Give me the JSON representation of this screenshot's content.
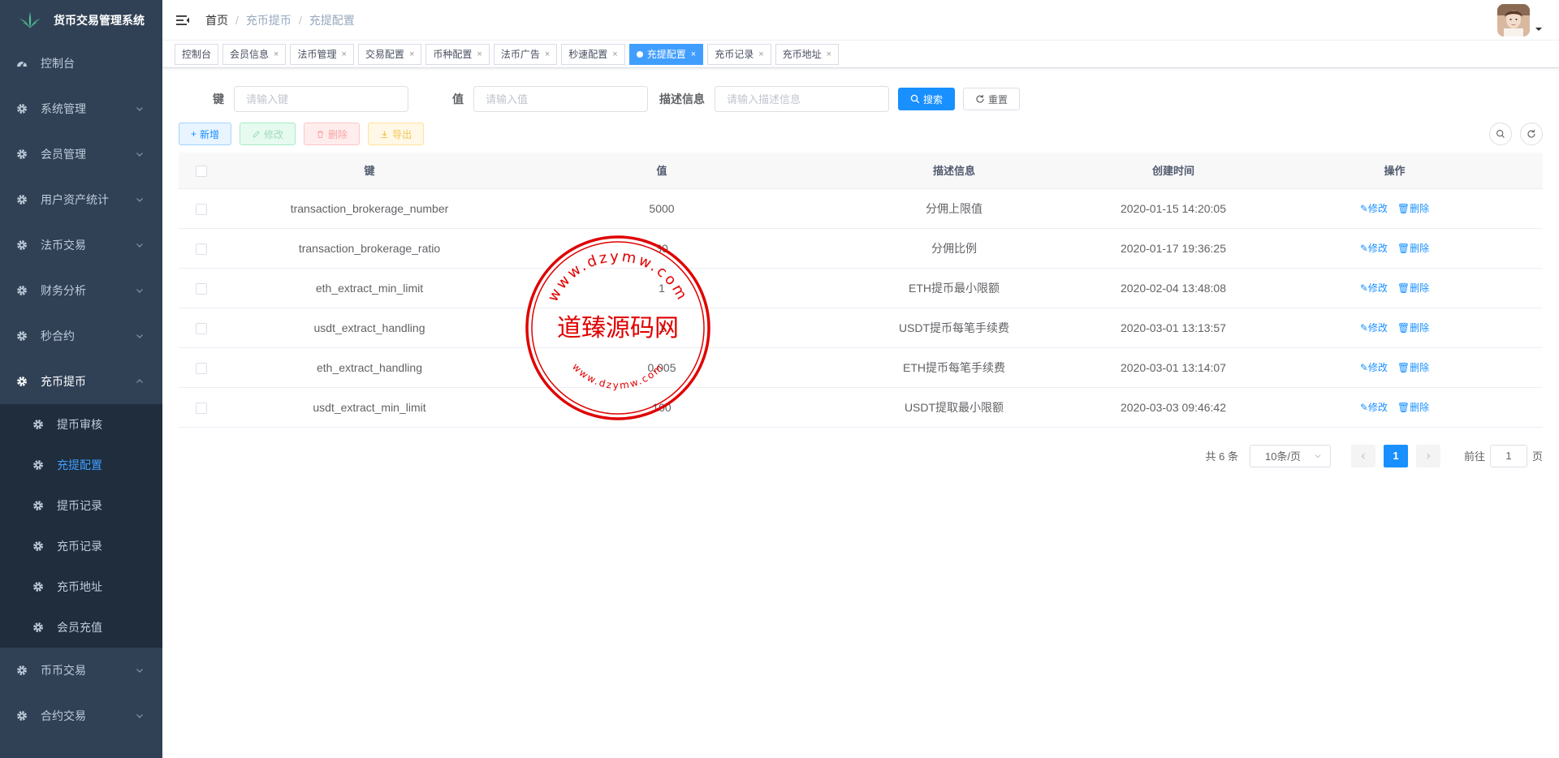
{
  "app": {
    "title": "货币交易管理系统"
  },
  "sidebar": {
    "items": [
      {
        "label": "控制台"
      },
      {
        "label": "系统管理"
      },
      {
        "label": "会员管理"
      },
      {
        "label": "用户资产统计"
      },
      {
        "label": "法币交易"
      },
      {
        "label": "财务分析"
      },
      {
        "label": "秒合约"
      },
      {
        "label": "充币提币"
      }
    ],
    "submenu": [
      {
        "label": "提币审核"
      },
      {
        "label": "充提配置"
      },
      {
        "label": "提币记录"
      },
      {
        "label": "充币记录"
      },
      {
        "label": "充币地址"
      },
      {
        "label": "会员充值"
      }
    ],
    "after": [
      {
        "label": "币币交易"
      },
      {
        "label": "合约交易"
      }
    ]
  },
  "breadcrumb": [
    "首页",
    "充币提币",
    "充提配置"
  ],
  "tabs": [
    {
      "label": "控制台"
    },
    {
      "label": "会员信息"
    },
    {
      "label": "法币管理"
    },
    {
      "label": "交易配置"
    },
    {
      "label": "币种配置"
    },
    {
      "label": "法币广告"
    },
    {
      "label": "秒速配置"
    },
    {
      "label": "充提配置"
    },
    {
      "label": "充币记录"
    },
    {
      "label": "充币地址"
    }
  ],
  "search": {
    "key_label": "键",
    "key_placeholder": "请输入键",
    "value_label": "值",
    "value_placeholder": "请输入值",
    "desc_label": "描述信息",
    "desc_placeholder": "请输入描述信息",
    "search_button": "搜索",
    "reset_button": "重置"
  },
  "toolbar": {
    "add": "新增",
    "edit": "修改",
    "delete": "删除",
    "export": "导出"
  },
  "table": {
    "headers": [
      "键",
      "值",
      "描述信息",
      "创建时间",
      "操作"
    ],
    "rows": [
      {
        "key": "transaction_brokerage_number",
        "value": "5000",
        "desc": "分佣上限值",
        "time": "2020-01-15 14:20:05"
      },
      {
        "key": "transaction_brokerage_ratio",
        "value": "30",
        "desc": "分佣比例",
        "time": "2020-01-17 19:36:25"
      },
      {
        "key": "eth_extract_min_limit",
        "value": "1",
        "desc": "ETH提币最小限额",
        "time": "2020-02-04 13:48:08"
      },
      {
        "key": "usdt_extract_handling",
        "value": "1",
        "desc": "USDT提币每笔手续费",
        "time": "2020-03-01 13:13:57"
      },
      {
        "key": "eth_extract_handling",
        "value": "0.005",
        "desc": "ETH提币每笔手续费",
        "time": "2020-03-01 13:14:07"
      },
      {
        "key": "usdt_extract_min_limit",
        "value": "100",
        "desc": "USDT提取最小限额",
        "time": "2020-03-03 09:46:42"
      }
    ],
    "op_edit": "修改",
    "op_delete": "删除"
  },
  "pagination": {
    "total": "共 6 条",
    "page_size": "10条/页",
    "current_page": "1",
    "jump_prefix": "前往",
    "jump_value": "1",
    "jump_suffix": "页"
  },
  "watermark": {
    "top_text": "www.dzymw.com",
    "center_text": "道臻源码网",
    "bottom_text": "www.dzymw.com"
  },
  "colors": {
    "sidebar": "#304156",
    "submenu": "#1f2d3d",
    "accent": "#1890ff",
    "stamp": "#e00000"
  }
}
